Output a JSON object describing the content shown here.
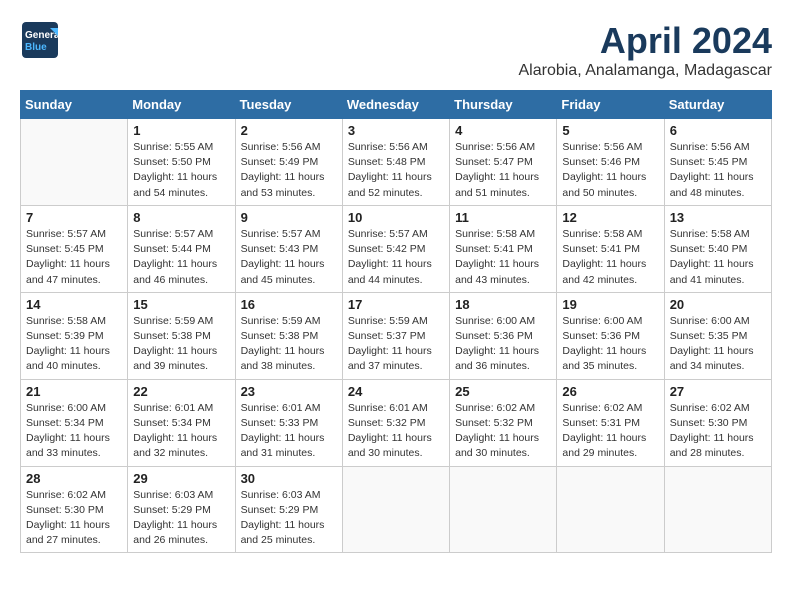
{
  "header": {
    "logo_line1": "General",
    "logo_line2": "Blue",
    "month": "April 2024",
    "location": "Alarobia, Analamanga, Madagascar"
  },
  "weekdays": [
    "Sunday",
    "Monday",
    "Tuesday",
    "Wednesday",
    "Thursday",
    "Friday",
    "Saturday"
  ],
  "weeks": [
    [
      {
        "day": "",
        "info": ""
      },
      {
        "day": "1",
        "info": "Sunrise: 5:55 AM\nSunset: 5:50 PM\nDaylight: 11 hours\nand 54 minutes."
      },
      {
        "day": "2",
        "info": "Sunrise: 5:56 AM\nSunset: 5:49 PM\nDaylight: 11 hours\nand 53 minutes."
      },
      {
        "day": "3",
        "info": "Sunrise: 5:56 AM\nSunset: 5:48 PM\nDaylight: 11 hours\nand 52 minutes."
      },
      {
        "day": "4",
        "info": "Sunrise: 5:56 AM\nSunset: 5:47 PM\nDaylight: 11 hours\nand 51 minutes."
      },
      {
        "day": "5",
        "info": "Sunrise: 5:56 AM\nSunset: 5:46 PM\nDaylight: 11 hours\nand 50 minutes."
      },
      {
        "day": "6",
        "info": "Sunrise: 5:56 AM\nSunset: 5:45 PM\nDaylight: 11 hours\nand 48 minutes."
      }
    ],
    [
      {
        "day": "7",
        "info": "Sunrise: 5:57 AM\nSunset: 5:45 PM\nDaylight: 11 hours\nand 47 minutes."
      },
      {
        "day": "8",
        "info": "Sunrise: 5:57 AM\nSunset: 5:44 PM\nDaylight: 11 hours\nand 46 minutes."
      },
      {
        "day": "9",
        "info": "Sunrise: 5:57 AM\nSunset: 5:43 PM\nDaylight: 11 hours\nand 45 minutes."
      },
      {
        "day": "10",
        "info": "Sunrise: 5:57 AM\nSunset: 5:42 PM\nDaylight: 11 hours\nand 44 minutes."
      },
      {
        "day": "11",
        "info": "Sunrise: 5:58 AM\nSunset: 5:41 PM\nDaylight: 11 hours\nand 43 minutes."
      },
      {
        "day": "12",
        "info": "Sunrise: 5:58 AM\nSunset: 5:41 PM\nDaylight: 11 hours\nand 42 minutes."
      },
      {
        "day": "13",
        "info": "Sunrise: 5:58 AM\nSunset: 5:40 PM\nDaylight: 11 hours\nand 41 minutes."
      }
    ],
    [
      {
        "day": "14",
        "info": "Sunrise: 5:58 AM\nSunset: 5:39 PM\nDaylight: 11 hours\nand 40 minutes."
      },
      {
        "day": "15",
        "info": "Sunrise: 5:59 AM\nSunset: 5:38 PM\nDaylight: 11 hours\nand 39 minutes."
      },
      {
        "day": "16",
        "info": "Sunrise: 5:59 AM\nSunset: 5:38 PM\nDaylight: 11 hours\nand 38 minutes."
      },
      {
        "day": "17",
        "info": "Sunrise: 5:59 AM\nSunset: 5:37 PM\nDaylight: 11 hours\nand 37 minutes."
      },
      {
        "day": "18",
        "info": "Sunrise: 6:00 AM\nSunset: 5:36 PM\nDaylight: 11 hours\nand 36 minutes."
      },
      {
        "day": "19",
        "info": "Sunrise: 6:00 AM\nSunset: 5:36 PM\nDaylight: 11 hours\nand 35 minutes."
      },
      {
        "day": "20",
        "info": "Sunrise: 6:00 AM\nSunset: 5:35 PM\nDaylight: 11 hours\nand 34 minutes."
      }
    ],
    [
      {
        "day": "21",
        "info": "Sunrise: 6:00 AM\nSunset: 5:34 PM\nDaylight: 11 hours\nand 33 minutes."
      },
      {
        "day": "22",
        "info": "Sunrise: 6:01 AM\nSunset: 5:34 PM\nDaylight: 11 hours\nand 32 minutes."
      },
      {
        "day": "23",
        "info": "Sunrise: 6:01 AM\nSunset: 5:33 PM\nDaylight: 11 hours\nand 31 minutes."
      },
      {
        "day": "24",
        "info": "Sunrise: 6:01 AM\nSunset: 5:32 PM\nDaylight: 11 hours\nand 30 minutes."
      },
      {
        "day": "25",
        "info": "Sunrise: 6:02 AM\nSunset: 5:32 PM\nDaylight: 11 hours\nand 30 minutes."
      },
      {
        "day": "26",
        "info": "Sunrise: 6:02 AM\nSunset: 5:31 PM\nDaylight: 11 hours\nand 29 minutes."
      },
      {
        "day": "27",
        "info": "Sunrise: 6:02 AM\nSunset: 5:30 PM\nDaylight: 11 hours\nand 28 minutes."
      }
    ],
    [
      {
        "day": "28",
        "info": "Sunrise: 6:02 AM\nSunset: 5:30 PM\nDaylight: 11 hours\nand 27 minutes."
      },
      {
        "day": "29",
        "info": "Sunrise: 6:03 AM\nSunset: 5:29 PM\nDaylight: 11 hours\nand 26 minutes."
      },
      {
        "day": "30",
        "info": "Sunrise: 6:03 AM\nSunset: 5:29 PM\nDaylight: 11 hours\nand 25 minutes."
      },
      {
        "day": "",
        "info": ""
      },
      {
        "day": "",
        "info": ""
      },
      {
        "day": "",
        "info": ""
      },
      {
        "day": "",
        "info": ""
      }
    ]
  ]
}
